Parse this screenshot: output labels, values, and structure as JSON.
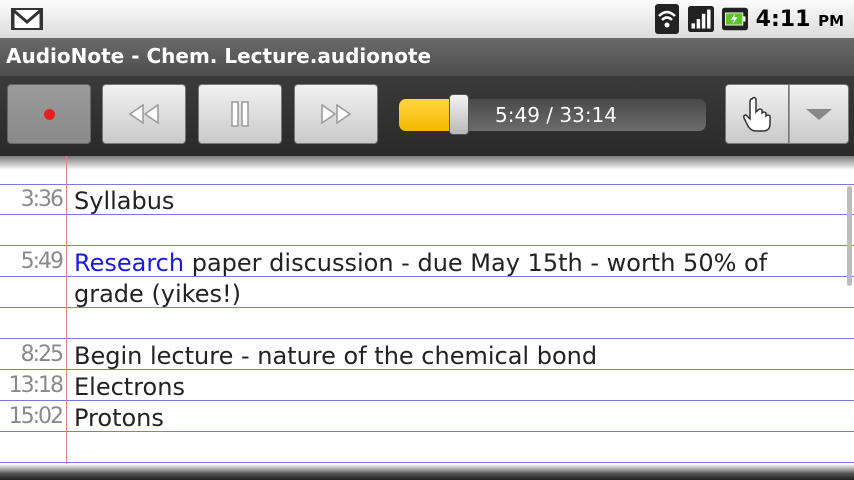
{
  "status_bar": {
    "time": "4:11",
    "ampm": "PM",
    "icons": [
      "gmail-icon",
      "wifi-icon",
      "signal-icon",
      "battery-charging-icon"
    ]
  },
  "title_bar": {
    "title": "AudioNote - Chem. Lecture.audionote"
  },
  "player": {
    "position": "5:49",
    "duration": "33:14",
    "progress_text": "5:49 / 33:14",
    "progress_fraction": 0.175,
    "accent_color": "#f5b800",
    "record_color": "#e81e1e"
  },
  "notes": [
    {
      "timestamp": "3:36",
      "text": "Syllabus"
    },
    {
      "timestamp": "5:49",
      "link": "Research",
      "text": " paper discussion - due May 15th - worth 50% of",
      "text2": "grade (yikes!)"
    },
    {
      "timestamp": "8:25",
      "text": "Begin lecture - nature of the chemical bond"
    },
    {
      "timestamp": "13:18",
      "text": "Electrons"
    },
    {
      "timestamp": "15:02",
      "text": "Protons"
    }
  ]
}
